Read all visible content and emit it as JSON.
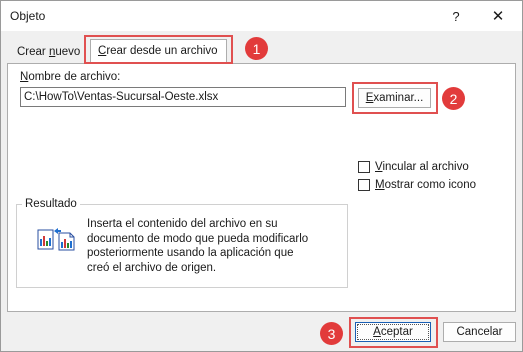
{
  "window": {
    "title": "Objeto",
    "help_glyph": "?",
    "close_glyph": "✕"
  },
  "tabs": [
    {
      "prefix": "Crear ",
      "underline": "n",
      "rest": "uevo"
    },
    {
      "prefix": "",
      "underline": "C",
      "rest": "rear desde un archivo",
      "active": true
    }
  ],
  "form": {
    "filename_label_underline": "N",
    "filename_label_rest": "ombre de archivo:",
    "filename_value": "C:\\HowTo\\Ventas-Sucursal-Oeste.xlsx",
    "browse_underline": "E",
    "browse_rest": "xaminar...",
    "link_underline": "V",
    "link_rest": "incular al archivo",
    "icon_underline": "M",
    "icon_rest": "ostrar como icono"
  },
  "result": {
    "legend": "Resultado",
    "lines": [
      "Inserta el contenido del archivo en su",
      "documento de modo que pueda modificarlo",
      "posteriormente usando la aplicación que",
      "creó el archivo de origen."
    ],
    "icon": "embedded-document-icon"
  },
  "buttons": {
    "ok_underline": "A",
    "ok_rest": "ceptar",
    "cancel": "Cancelar"
  },
  "badges": [
    "1",
    "2",
    "3"
  ],
  "colors": {
    "highlight": "#e05050",
    "badge": "#e23b3b",
    "dialog_bg": "#f0f0f0"
  }
}
